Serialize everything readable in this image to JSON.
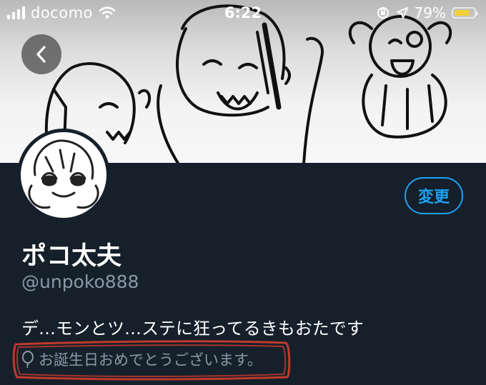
{
  "status_bar": {
    "carrier": "docomo",
    "time": "6:22",
    "battery_percent": "79%",
    "battery_level": 0.79
  },
  "profile": {
    "edit_label": "変更",
    "display_name": "ポコ太夫",
    "handle": "@unpoko888",
    "bio": "デ…モンとツ…ステに狂ってるきもおたです",
    "birthday_text": "お誕生日おめでとうございます。"
  },
  "colors": {
    "background": "#15202b",
    "accent": "#1da1f2",
    "secondary_text": "#8899a6",
    "annotation": "#c0392b"
  },
  "icons": [
    "back-arrow-icon",
    "wifi-icon",
    "location-arrow-icon",
    "orientation-lock-icon",
    "battery-icon",
    "balloon-icon"
  ]
}
